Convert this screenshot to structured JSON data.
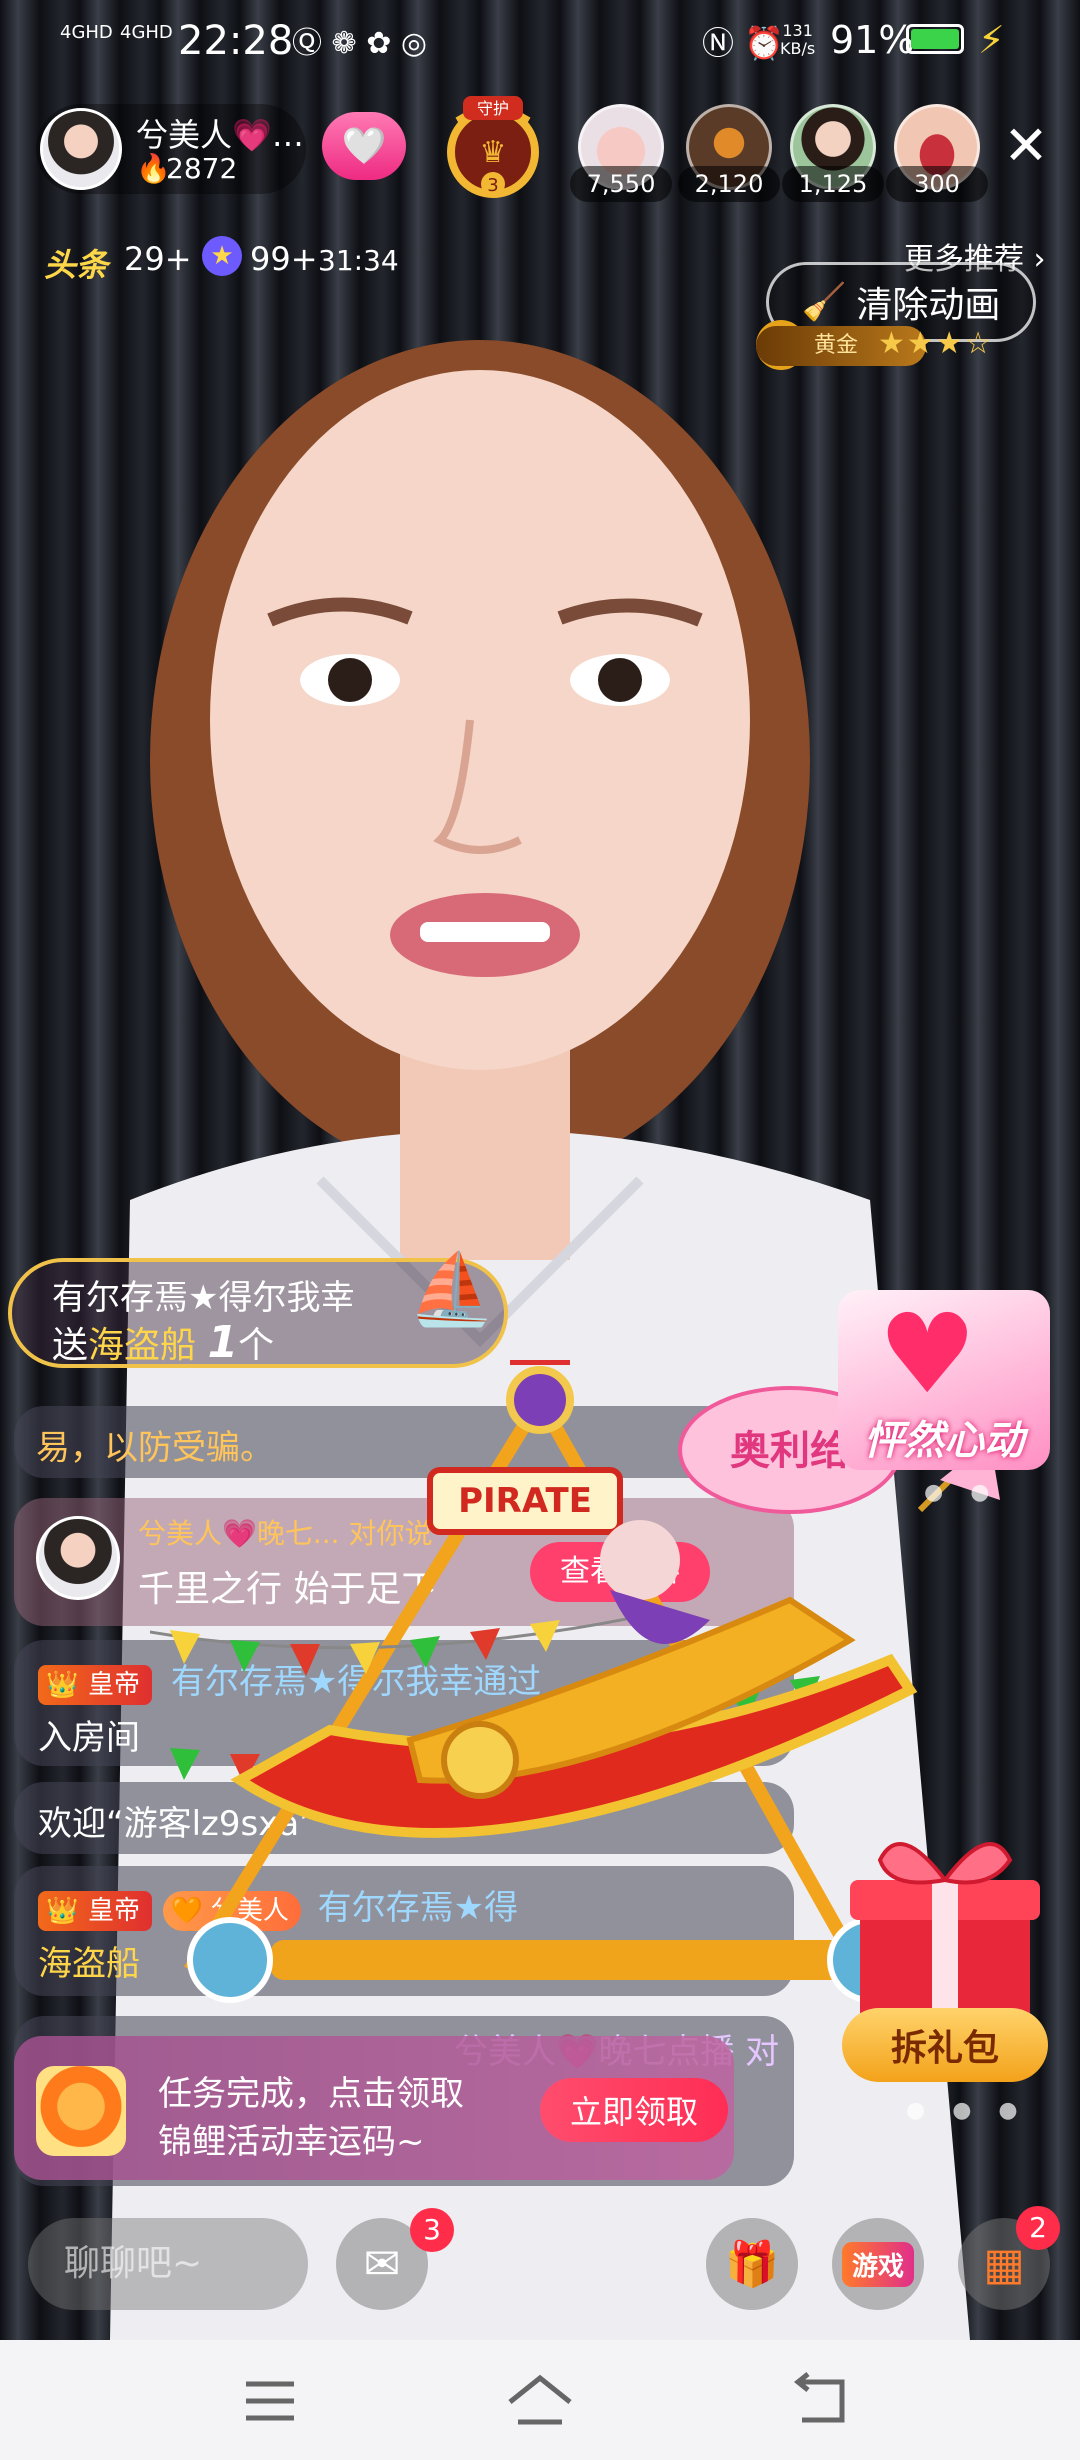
{
  "status_bar": {
    "signal1": "4GHD",
    "signal2": "4GHD",
    "time": "22:28",
    "net_speed_value": "131",
    "net_speed_unit": "KB/s",
    "battery": "91%"
  },
  "header": {
    "host_name": "兮美人💗…",
    "host_heat": "2872",
    "guard_label": "守护",
    "guard_count": "3",
    "viewers": [
      {
        "count": "7,550"
      },
      {
        "count": "2,120"
      },
      {
        "count": "1,125"
      },
      {
        "count": "300"
      }
    ]
  },
  "row2": {
    "toutiao_label": "头条",
    "toutiao_count": "29+",
    "star_count": "99+",
    "timer": "31:34",
    "more_recommend": "更多推荐 ›",
    "clear_animation": "清除动画",
    "level_badge": "黄金",
    "stars": "★★★☆"
  },
  "gift_banner": {
    "sender": "有尔存焉★得尔我幸",
    "send_verb": "送",
    "gift_name": "海盗船",
    "gift_count": "1",
    "gift_unit": "个"
  },
  "chat": {
    "msg1_text": "易，以防受骗。",
    "msg2_name": "兮美人💗晚七... 对你说",
    "msg2_text": "千里之行 始于足下",
    "msg2_profile_btn": "查看资料",
    "msg3_tag": "皇帝",
    "msg3_text_1": "有尔存焉★得尔我幸通过",
    "msg3_text_2": "入房间",
    "msg4_text": "欢迎“游客lz9sxa”",
    "msg5_tag": "皇帝",
    "msg5_fan_tag": "兮美人",
    "msg5_text_1": "有尔存焉★得",
    "msg5_text_2": "海盗船",
    "msg6_text": "兮美人💗晚七点播 对"
  },
  "ship_animation": {
    "sign": "PIRATE",
    "bubble_text": "奥利给"
  },
  "right_promos": {
    "promo_text": "怦然心动",
    "gift_pack_label": "拆礼包"
  },
  "task_toast": {
    "line1": "任务完成，点击领取",
    "line2": "锦鲤活动幸运码~",
    "claim_button": "立即领取"
  },
  "bottom_bar": {
    "chat_placeholder": "聊聊吧~",
    "mail_badge": "3",
    "game_label": "游戏",
    "more_badge": "2"
  },
  "colors": {
    "accent_pink": "#ff2d55",
    "gold": "#ffd54a",
    "badge_red": "#ff2d4a"
  }
}
